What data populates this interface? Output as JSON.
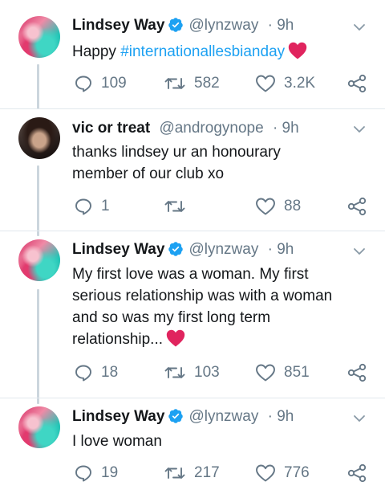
{
  "tweets": [
    {
      "name": "Lindsey Way",
      "handle": "@lynzway",
      "time": "· 9h",
      "verified": true,
      "text_before": "Happy ",
      "hashtag": "#internationallesbianday",
      "text_lines": [],
      "heart": true,
      "replies": "109",
      "retweets": "582",
      "likes": "3.2K"
    },
    {
      "name": "vic or treat",
      "handle": "@androgynope",
      "time": "· 9h",
      "verified": false,
      "text_lines": [
        "thanks lindsey ur an honourary",
        "member of our club xo"
      ],
      "replies": "1",
      "retweets": "",
      "likes": "88"
    },
    {
      "name": "Lindsey Way",
      "handle": "@lynzway",
      "time": "· 9h",
      "verified": true,
      "text_lines": [
        "My first love was a woman. My first",
        "serious relationship was with a woman",
        "and so was my first long term",
        "relationship..."
      ],
      "heart": true,
      "replies": "18",
      "retweets": "103",
      "likes": "851"
    },
    {
      "name": "Lindsey Way",
      "handle": "@lynzway",
      "time": "· 9h",
      "verified": true,
      "text_lines": [
        "I love woman"
      ],
      "replies": "19",
      "retweets": "217",
      "likes": "776"
    }
  ],
  "colors": {
    "verified": "#1da1f2",
    "hashtag": "#1da1f2",
    "heart": "#e0245e",
    "muted": "#657786"
  }
}
